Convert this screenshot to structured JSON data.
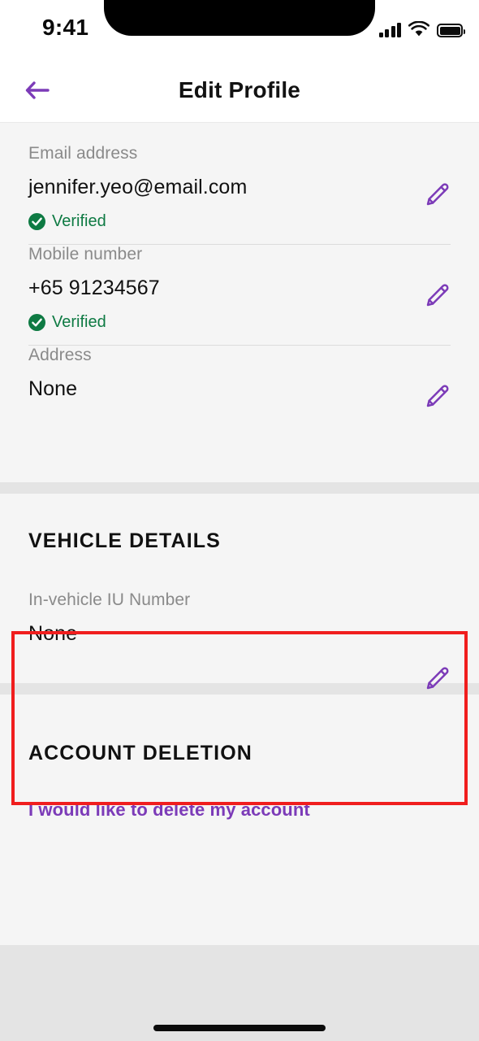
{
  "status_bar": {
    "time": "9:41",
    "signal_icon": "cellular-signal-icon",
    "wifi_icon": "wifi-icon",
    "battery_icon": "battery-full-icon"
  },
  "header": {
    "title": "Edit Profile",
    "back_icon": "arrow-left-icon"
  },
  "colors": {
    "accent_purple": "#7c3bb8",
    "verified_green": "#0e7a43",
    "annotation_red": "#f01e1e",
    "card_background": "#f5f5f5",
    "page_background": "#e4e4e4"
  },
  "contact_section": {
    "fields": [
      {
        "label": "Email address",
        "value": "jennifer.yeo@email.com",
        "verified": true,
        "verified_label": "Verified",
        "edit_icon": "pencil-icon"
      },
      {
        "label": "Mobile number",
        "value": "+65 91234567",
        "verified": true,
        "verified_label": "Verified",
        "edit_icon": "pencil-icon"
      },
      {
        "label": "Address",
        "value": "None",
        "verified": false,
        "verified_label": "",
        "edit_icon": "pencil-icon"
      }
    ]
  },
  "vehicle_section": {
    "title": "VEHICLE DETAILS",
    "field": {
      "label": "In-vehicle IU Number",
      "value": "None",
      "edit_icon": "pencil-icon"
    },
    "highlighted": true
  },
  "deletion_section": {
    "title": "ACCOUNT DELETION",
    "link_label": "I would like to delete my account"
  }
}
